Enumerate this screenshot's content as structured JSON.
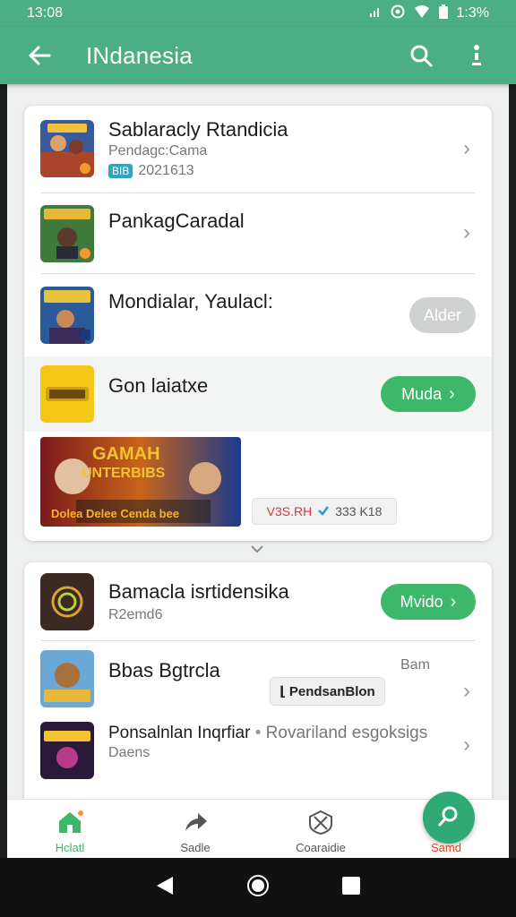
{
  "status": {
    "time": "13:08",
    "battery": "1:3%"
  },
  "app_bar": {
    "title": "INdanesia"
  },
  "card1": {
    "rows": [
      {
        "title": "Sablaracly Rtandicia",
        "subtitle": "Pendagc:Cama",
        "tag": "BIB",
        "meta": "2021613"
      },
      {
        "title": "PankagCaradal"
      },
      {
        "title": "Mondialar, Yaulacl:",
        "action": "Alder"
      },
      {
        "title": "Gon laiatxe",
        "action": "Muda"
      }
    ],
    "banner": {
      "line1": "GAMAH",
      "line2": "UNTERBIBS",
      "line3": "Dolea Delee Cenda bee"
    },
    "meta_chip": {
      "left": "V3S.RH",
      "right": "333 K18"
    }
  },
  "card2": {
    "rows": [
      {
        "title": "Bamacla isrtidensika",
        "subtitle": "R2emd6",
        "action": "Mvido"
      },
      {
        "title": "Bbas Bgtrcla",
        "chip": "PendsanBlon",
        "right_text": "Bam"
      },
      {
        "title": "Ponsalnlan Inqrfiar",
        "secondary": "Rovariland esgoksigs",
        "subtitle": "Daens"
      }
    ]
  },
  "bottom_nav": {
    "items": [
      {
        "label": "Hclatl"
      },
      {
        "label": "Sadle"
      },
      {
        "label": "Coaraidie"
      },
      {
        "label": "Samd"
      }
    ]
  },
  "colors": {
    "primary": "#4cae84",
    "accent": "#3db86a",
    "fab": "#2fa976"
  }
}
